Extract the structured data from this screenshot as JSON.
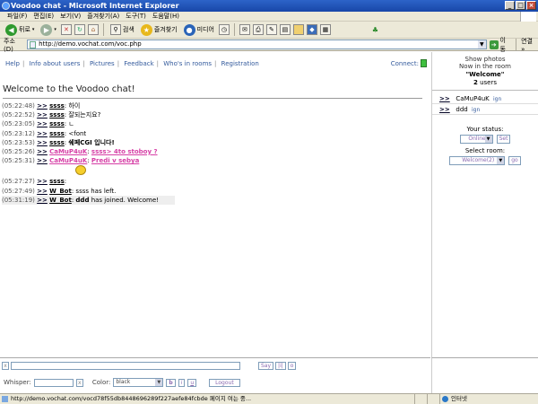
{
  "window": {
    "title": "Voodoo chat - Microsoft Internet Explorer",
    "controls": [
      "_",
      "□",
      "×"
    ]
  },
  "menu": [
    "파일(F)",
    "편집(E)",
    "보기(V)",
    "즐겨찾기(A)",
    "도구(T)",
    "도움말(H)"
  ],
  "toolbar": {
    "back_label": "뒤로",
    "search_label": "검색",
    "favorites_label": "즐겨찾기",
    "media_label": "미디어"
  },
  "address": {
    "label": "주소(D)",
    "url": "http://demo.vochat.com/voc.php",
    "go_label": "이동",
    "links_label": "연결 »"
  },
  "nav": {
    "links": [
      "Help",
      "Info about users",
      "Pictures",
      "Feedback",
      "Who's in rooms",
      "Registration"
    ],
    "connect_label": "Connect:"
  },
  "chat": {
    "welcome": "Welcome to the Voodoo chat!",
    "messages": [
      {
        "time": "(05:22:48)",
        "arrow": ">>",
        "nick": "ssss",
        "text": "하이"
      },
      {
        "time": "(05:22:52)",
        "arrow": ">>",
        "nick": "ssss",
        "text": "잘되는지요?"
      },
      {
        "time": "(05:23:05)",
        "arrow": ">>",
        "nick": "ssss",
        "text": "ㄴ"
      },
      {
        "time": "(05:23:12)",
        "arrow": ">>",
        "nick": "ssss",
        "text": "<font"
      },
      {
        "time": "(05:23:53)",
        "arrow": ">>",
        "nick": "ssss",
        "text": "쉐페CGI 입니다!"
      },
      {
        "time": "(05:25:26)",
        "arrow": ">>",
        "nick": "CaMuP4uK",
        "text": "ssss> 4to stoboy ?"
      },
      {
        "time": "(05:25:31)",
        "arrow": ">>",
        "nick": "CaMuP4uK",
        "text": "Predi v sebya"
      },
      {
        "time": "(05:27:27)",
        "arrow": ">>",
        "nick": "ssss",
        "text": ""
      },
      {
        "time": "(05:27:49)",
        "arrow": ">>",
        "nick": "W_Bot",
        "text": "ssss has left."
      },
      {
        "time": "(05:31:19)",
        "arrow": ">>",
        "nick": "W_Bot",
        "text_bold": "ddd",
        "text": "has joined. Welcome!"
      }
    ]
  },
  "room": {
    "show_photos": "Show photos",
    "now_in": "Now in the room",
    "name": "\"Welcome\"",
    "user_count": "2",
    "users_label": "users",
    "users": [
      {
        "arrow": ">>",
        "name": "CaMuP4uK",
        "ignore": "ign"
      },
      {
        "arrow": ">>",
        "name": "ddd",
        "ignore": "ign"
      }
    ],
    "status_label": "Your status:",
    "status_value": "Online",
    "set_label": "Set",
    "select_room_label": "Select room:",
    "room_value": "Welcome(2)",
    "go_label": "go"
  },
  "input": {
    "x": "x",
    "say_label": "Say",
    "btn_i": "|i|",
    "btn_o": "o",
    "whisper_label": "Whisper:",
    "color_label": "Color:",
    "color_value": "black",
    "bold_label": "b",
    "italic_label": "i",
    "underline_label": "u",
    "logout_label": "Logout"
  },
  "statusbar": {
    "url": "http://demo.vochat.com/vocd78f55db8448696289f227aefe84fcbde 페이지 여는 중...",
    "zone": "인터넷"
  }
}
